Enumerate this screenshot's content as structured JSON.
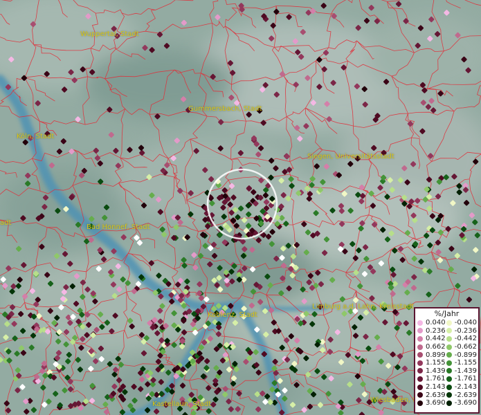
{
  "cities": [
    {
      "name": "Wuppertal, Stadt"
    },
    {
      "name": "Gummersbach, Stadt"
    },
    {
      "name": "Köln, Stadt"
    },
    {
      "name": "Siegen, Universitätsstadt"
    },
    {
      "name": "Bad Honnef, Stadt"
    },
    {
      "name": "adt"
    },
    {
      "name": "Koblenz, Stadt"
    },
    {
      "name": "Limburg a.d. Lahn, Kreisstadt"
    },
    {
      "name": "Kastellaun, Stadt"
    },
    {
      "name": "Wiesbaden, L"
    }
  ],
  "legend": {
    "title": "%/Jahr",
    "positive": [
      {
        "label": "0.040",
        "color": "#f4b8e4"
      },
      {
        "label": "0.236",
        "color": "#e39ac9"
      },
      {
        "label": "0.442",
        "color": "#d47fa9"
      },
      {
        "label": "0.662",
        "color": "#c06a8e"
      },
      {
        "label": "0.899",
        "color": "#a84e70"
      },
      {
        "label": "1.155",
        "color": "#93385c"
      },
      {
        "label": "1.439",
        "color": "#7b2647"
      },
      {
        "label": "1.761",
        "color": "#651634"
      },
      {
        "label": "2.143",
        "color": "#4f0a22"
      },
      {
        "label": "2.639",
        "color": "#3a0416"
      },
      {
        "label": "3.690",
        "color": "#22000a"
      }
    ],
    "negative": [
      {
        "label": "-0.040",
        "color": "#f1f7c6"
      },
      {
        "label": "-0.236",
        "color": "#d6efa7"
      },
      {
        "label": "-0.442",
        "color": "#b7df8a"
      },
      {
        "label": "-0.662",
        "color": "#8fc86a"
      },
      {
        "label": "-0.899",
        "color": "#66ad4d"
      },
      {
        "label": "-1.155",
        "color": "#449338"
      },
      {
        "label": "-1.439",
        "color": "#2a7a27"
      },
      {
        "label": "-1.761",
        "color": "#16621a"
      },
      {
        "label": "-2.143",
        "color": "#0a4b10"
      },
      {
        "label": "-2.639",
        "color": "#043508"
      },
      {
        "label": "-3.690",
        "color": "#012003"
      }
    ]
  },
  "colors": {
    "terrain": "#8fa9a1",
    "river": "#4f93b4",
    "borders": "#e0303a",
    "city_label": "#d7c51a",
    "highlight_circle": "#ffffff"
  }
}
